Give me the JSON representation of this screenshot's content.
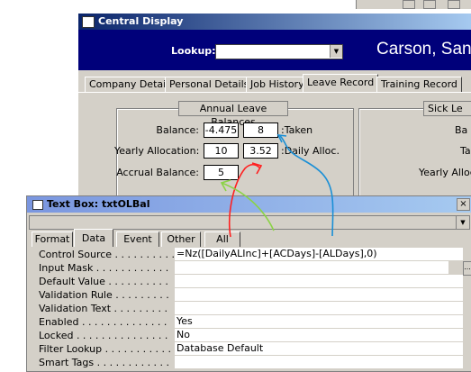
{
  "central_display": {
    "title": "Central Display",
    "lookup_label": "Lookup:",
    "lookup_value": "",
    "employee_name": "Carson, Sand",
    "tabs": [
      "Company Details",
      "Personal Details",
      "Job History",
      "Leave Record",
      "Training Record"
    ],
    "active_tab": "Leave Record",
    "annual_group": {
      "title": "Annual Leave Balances",
      "balance_label": "Balance:",
      "balance_value": "-4.475",
      "taken_value": "8",
      "taken_label": ":Taken",
      "yearly_label": "Yearly Allocation:",
      "yearly_value": "10",
      "daily_value": "3.52",
      "daily_label": ":Daily Alloc.",
      "accrual_label": "Accrual Balance:",
      "accrual_value": "5"
    },
    "sick_group": {
      "title": "Sick Le",
      "labels": [
        "Ba",
        "Ta",
        "Yearly Alloca"
      ]
    }
  },
  "property_sheet": {
    "title": "Text Box: txtOLBal",
    "selector_value": "txtOLBal",
    "tabs": [
      "Format",
      "Data",
      "Event",
      "Other",
      "All"
    ],
    "active_tab": "Data",
    "properties": [
      {
        "name": "Control Source . . . . . . . . . .",
        "value": "=Nz([DailyALInc]+[ACDays]-[ALDays],0)"
      },
      {
        "name": "Input Mask . . . . . . . . . . . .",
        "value": ""
      },
      {
        "name": "Default Value . . . . . . . . . .",
        "value": ""
      },
      {
        "name": "Validation Rule . . . . . . . . .",
        "value": ""
      },
      {
        "name": "Validation Text . . . . . . . . .",
        "value": ""
      },
      {
        "name": "Enabled . . . . . . . . . . . . . .",
        "value": "Yes"
      },
      {
        "name": "Locked . . . . . . . . . . . . . . .",
        "value": "No"
      },
      {
        "name": "Filter Lookup . . . . . . . . . . .",
        "value": "Database Default"
      },
      {
        "name": "Smart Tags . . . . . . . . . . . .",
        "value": ""
      }
    ],
    "build_button": "..."
  },
  "annotations": {
    "colors": {
      "red": "#ff2020",
      "green": "#8bd346",
      "blue": "#1a8fd6"
    }
  }
}
